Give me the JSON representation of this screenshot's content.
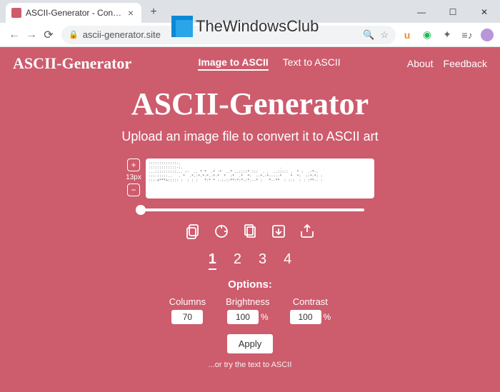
{
  "browser": {
    "tab_title": "ASCII-Generator - Convert image...",
    "address": "ascii-generator.site",
    "window_controls": {
      "min": "—",
      "max": "☐",
      "close": "✕"
    }
  },
  "watermark": "TheWindowsClub",
  "nav": {
    "brand": "ASCII-Generator",
    "image_to_ascii": "Image to ASCII",
    "text_to_ascii": "Text to ASCII",
    "about": "About",
    "feedback": "Feedback"
  },
  "hero": {
    "title": "ASCII-Generator",
    "subtitle": "Upload an image file to convert it to ASCII art"
  },
  "zoom": {
    "plus": "+",
    "label": "13px",
    "minus": "−"
  },
  "ascii_preview": "::::::::::::::.\n:::::::::::::-:.                                             .\n...::::::::::... :-  .. * *  .* -*  ..* ..::::* :::  . .  ..::::: .  * :  .-*-.\n-::-::::-..   . *  .*.-*.*-*.-*-*  *  :*  .*  *:  :-*.-*-----*    *  *:  :-*-*: :\n:::-+***+::::: :  : : :   *:* * -.:-::**:*:*-:*.--* :   *--**  : :-:  : : :**-- :",
  "pager": {
    "p1": "1",
    "p2": "2",
    "p3": "3",
    "p4": "4"
  },
  "options": {
    "title": "Options:",
    "columns_label": "Columns",
    "columns_value": "70",
    "brightness_label": "Brightness",
    "brightness_value": "100",
    "contrast_label": "Contrast",
    "contrast_value": "100",
    "pct": "%",
    "apply": "Apply",
    "footnote": "...or try the text to ASCII"
  }
}
